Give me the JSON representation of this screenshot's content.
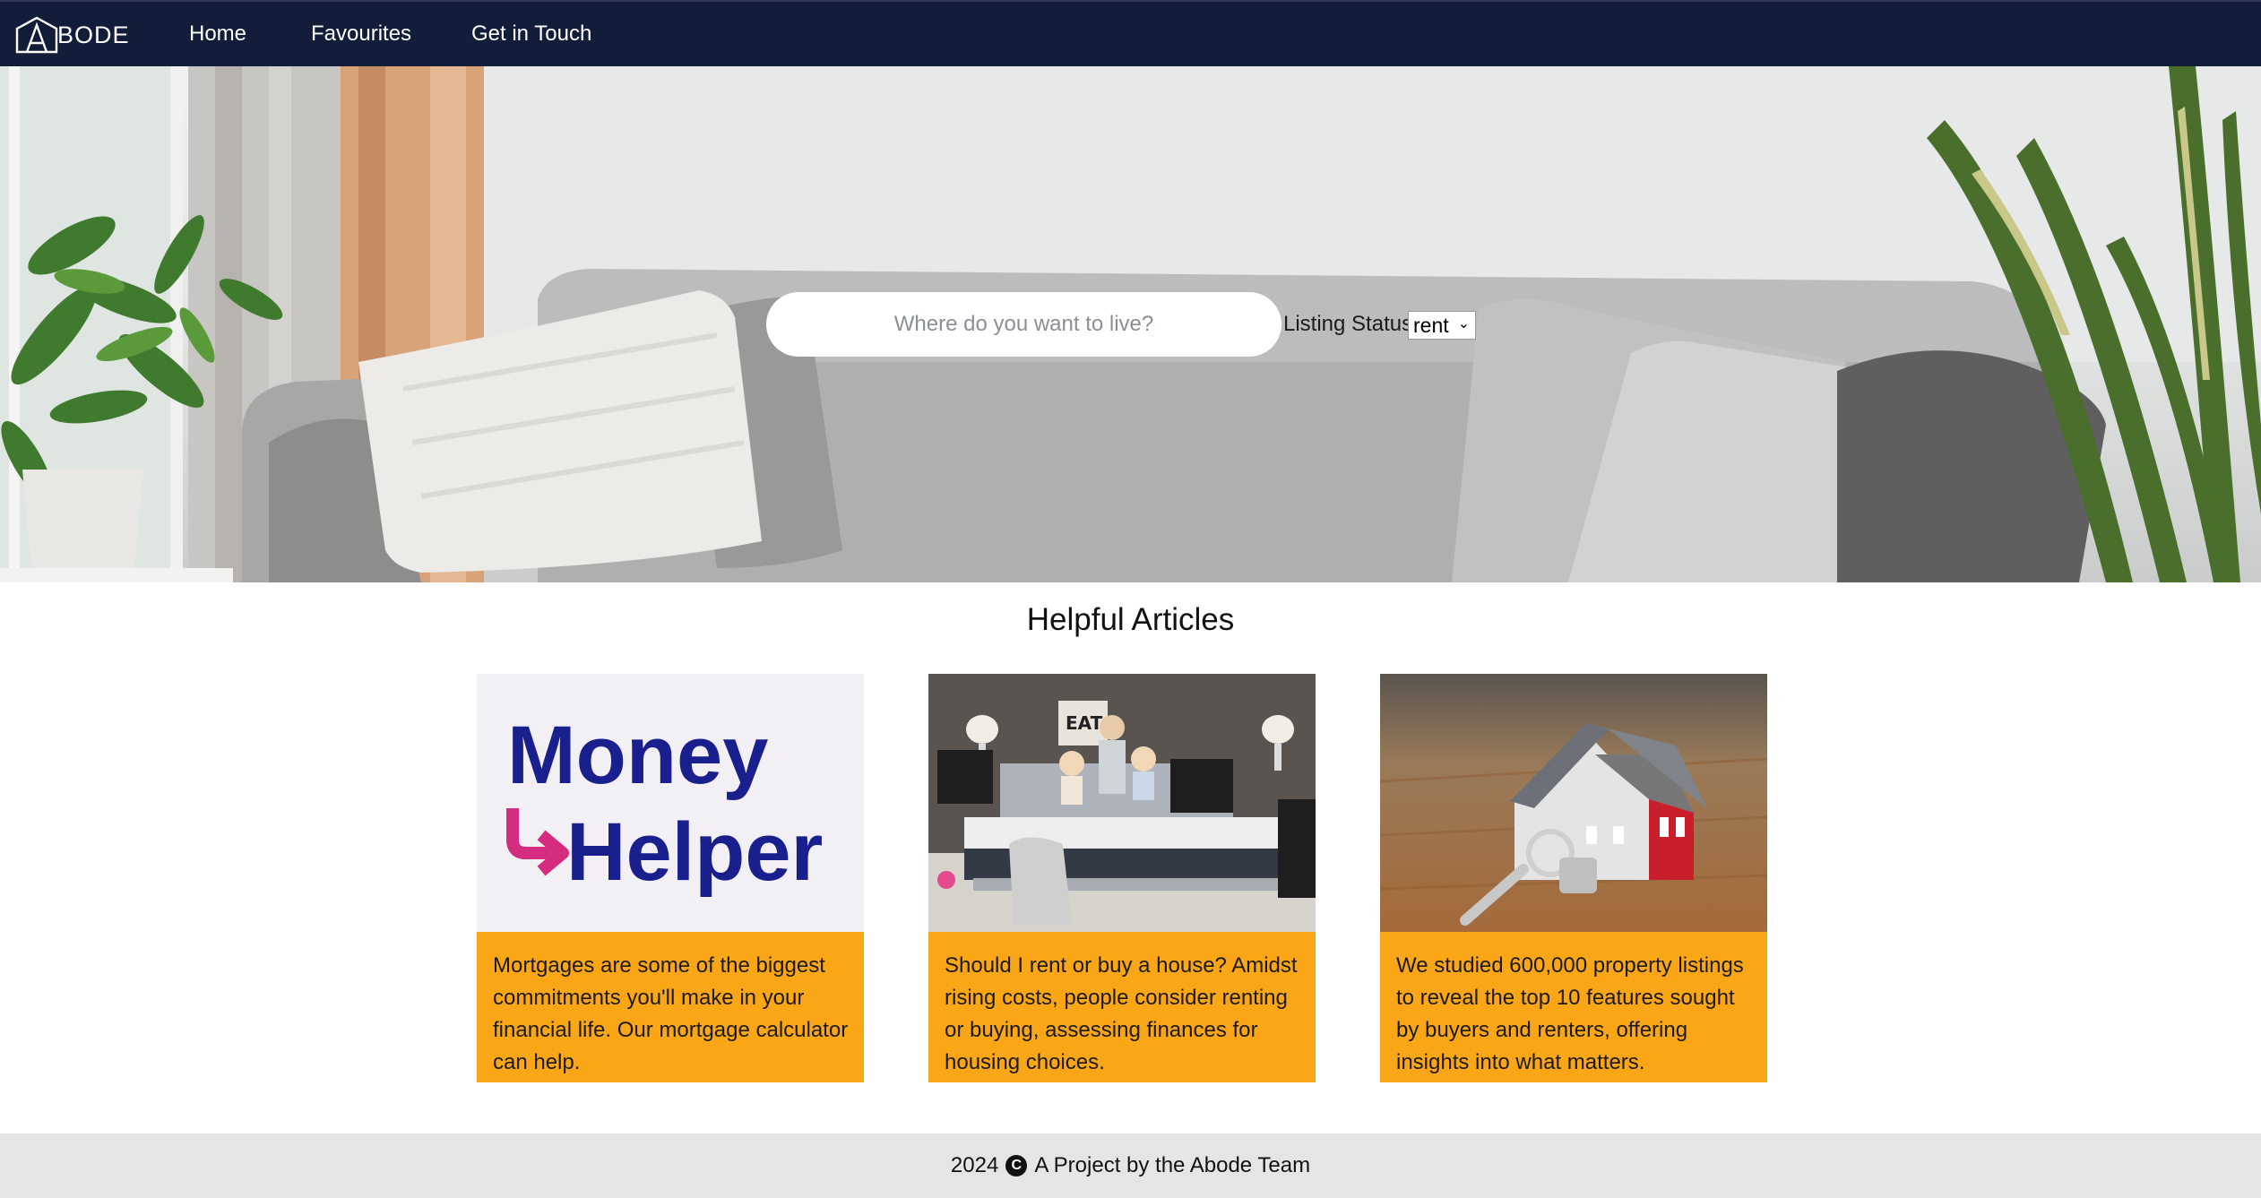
{
  "nav": {
    "logo_text": "BODE",
    "logo_icon": "house-a-logo-icon",
    "links": [
      "Home",
      "Favourites",
      "Get in Touch"
    ]
  },
  "hero": {
    "search_placeholder": "Where do you want to live?",
    "search_value": "",
    "status_label": "Listing Status",
    "status_selected": "rent"
  },
  "articles": {
    "title": "Helpful Articles",
    "cards": [
      {
        "image": "money-helper-logo",
        "logo_line1": "Money",
        "logo_line2": "Helper",
        "text": "Mortgages are some of the biggest commitments you'll make in your financial life. Our mortgage calculator can help."
      },
      {
        "image": "family-moving-photo",
        "sign": "EAT",
        "text": "Should I rent or buy a house? Amidst rising costs, people consider renting or buying, assessing finances for housing choices."
      },
      {
        "image": "house-model-keys-photo",
        "text": "We studied 600,000 property listings to reveal the top 10 features sought by buyers and renters, offering insights into what matters."
      }
    ]
  },
  "footer": {
    "year": "2024",
    "text": "A Project by the Abode Team",
    "icon": "copyright-icon"
  },
  "colors": {
    "nav_bg": "#121d3a",
    "accent": "#fba617",
    "footer_bg": "#e5e5e5",
    "money_helper_blue": "#1a1f8e",
    "money_helper_pink": "#d42d7f"
  }
}
